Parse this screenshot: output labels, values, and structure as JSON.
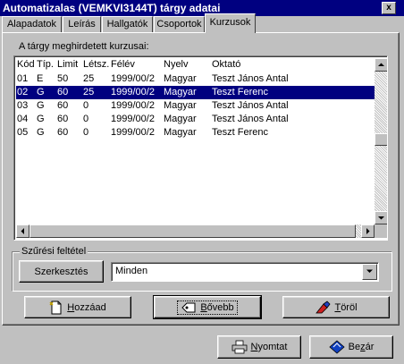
{
  "window": {
    "title": "Automatizalas (VEMKVI3144T) tárgy adatai",
    "close_glyph": "x"
  },
  "tabs": [
    {
      "label": "Alapadatok"
    },
    {
      "label": "Leírás"
    },
    {
      "label": "Hallgatók"
    },
    {
      "label": "Csoportok"
    },
    {
      "label": "Kurzusok",
      "active": true
    }
  ],
  "courses": {
    "group_label": "A tárgy meghirdetett kurzusai:",
    "columns": [
      "Kód",
      "Típ.",
      "Limit",
      "Létsz.",
      "Félév",
      "Nyelv",
      "Oktató"
    ],
    "rows": [
      {
        "kod": "01",
        "tip": "E",
        "limit": "50",
        "letsz": "25",
        "felev": "1999/00/2",
        "nyelv": "Magyar",
        "oktato": "Teszt János Antal",
        "selected": false
      },
      {
        "kod": "02",
        "tip": "G",
        "limit": "60",
        "letsz": "25",
        "felev": "1999/00/2",
        "nyelv": "Magyar",
        "oktato": "Teszt Ferenc",
        "selected": true
      },
      {
        "kod": "03",
        "tip": "G",
        "limit": "60",
        "letsz": "0",
        "felev": "1999/00/2",
        "nyelv": "Magyar",
        "oktato": "Teszt János Antal",
        "selected": false
      },
      {
        "kod": "04",
        "tip": "G",
        "limit": "60",
        "letsz": "0",
        "felev": "1999/00/2",
        "nyelv": "Magyar",
        "oktato": "Teszt János Antal",
        "selected": false
      },
      {
        "kod": "05",
        "tip": "G",
        "limit": "60",
        "letsz": "0",
        "felev": "1999/00/2",
        "nyelv": "Magyar",
        "oktato": "Teszt Ferenc",
        "selected": false
      }
    ]
  },
  "filter": {
    "group_label": "Szűrési feltétel",
    "edit_button": "Szerkesztés",
    "combo_value": "Minden"
  },
  "actions": {
    "add_prefix": "",
    "add_hotkey": "H",
    "add_rest": "ozzáad",
    "expand_hotkey": "B",
    "expand_rest": "ővebb",
    "delete_hotkey": "T",
    "delete_rest": "öröl"
  },
  "footer": {
    "print_hotkey": "N",
    "print_rest": "yomtat",
    "close_prefix": "Be",
    "close_hotkey": "z",
    "close_rest": "ár"
  },
  "colors": {
    "selection": "#000080",
    "titlebar": "#000080",
    "face": "#c0c0c0"
  },
  "icons": {
    "add": "new-document-icon",
    "expand": "zoom-tag-icon",
    "delete": "eraser-icon",
    "print": "printer-icon",
    "close": "exit-diamond-icon"
  }
}
